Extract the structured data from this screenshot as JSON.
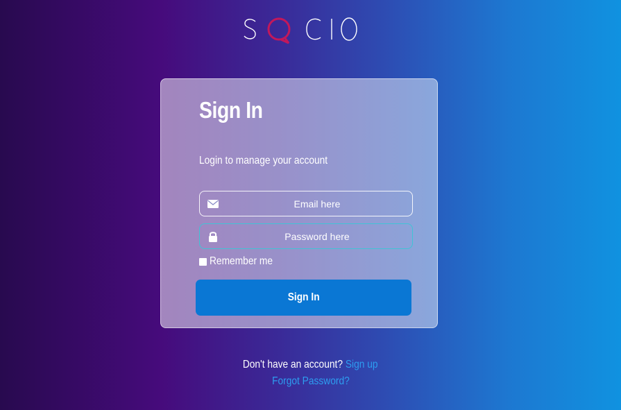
{
  "brand": {
    "logo_text": "SOCIO",
    "colors": {
      "logo_letters": "#ffffff",
      "logo_accent": "#c2185b"
    }
  },
  "signin": {
    "title": "Sign In",
    "subtitle": "Login to manage your account",
    "email": {
      "placeholder": "Email here",
      "value": "",
      "icon": "envelope-icon"
    },
    "password": {
      "placeholder": "Password here",
      "value": "",
      "icon": "lock-icon",
      "focused": true
    },
    "remember_label": "Remember me",
    "remember_checked": false,
    "submit_label": "Sign In"
  },
  "footer": {
    "no_account_text": "Don't have an account?",
    "signup_link": "Sign up",
    "forgot_link": "Forgot Password?"
  },
  "theme": {
    "button_color": "#0a77d4",
    "link_color": "#2d9df0",
    "focus_border": "#3fc4d6"
  }
}
